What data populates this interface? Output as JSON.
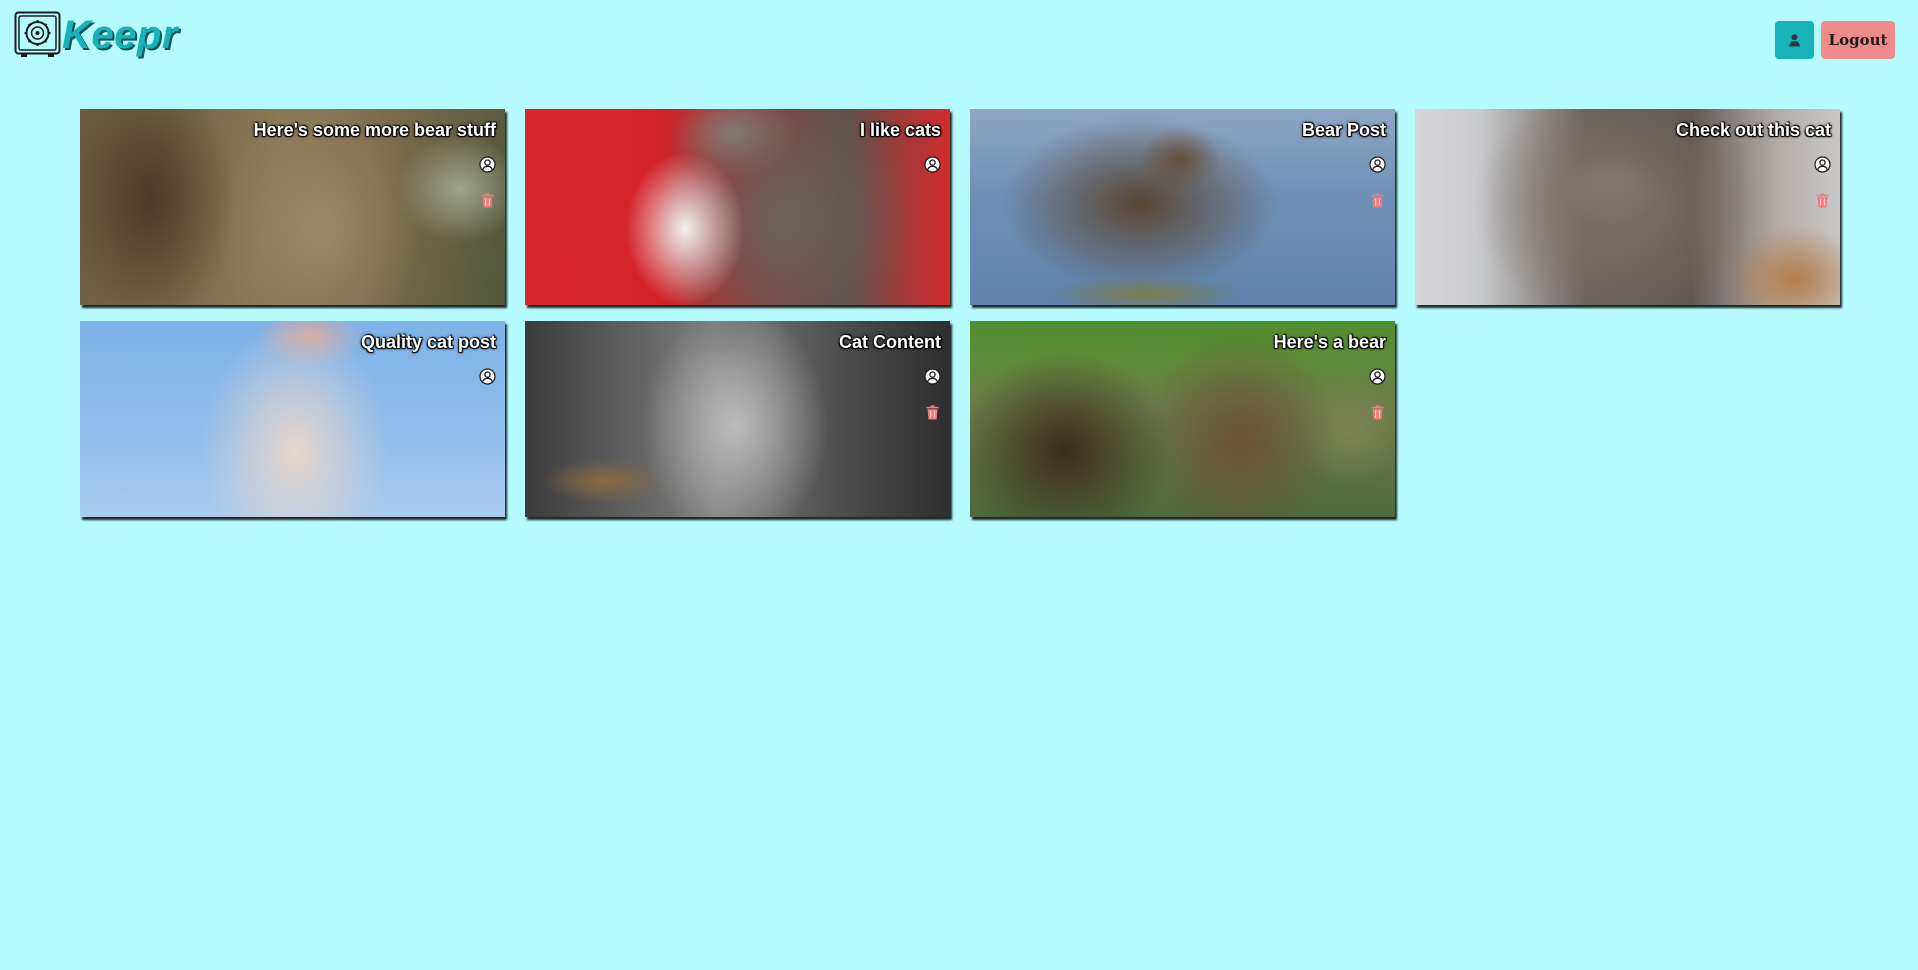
{
  "app": {
    "brand": "Keepr"
  },
  "header": {
    "profile_icon": "user-icon",
    "logout_label": "Logout"
  },
  "colors": {
    "background": "#b6fbff",
    "brand": "#17b3b8",
    "profile_button": "#17b3b8",
    "logout_button": "#ef8a8b",
    "delete_icon": "#ef7d7f"
  },
  "keeps": [
    {
      "title": "Here's some more bear stuff",
      "image": "bear-closeup",
      "has_delete": true
    },
    {
      "title": "I like cats",
      "image": "cat-red-background",
      "has_delete": false
    },
    {
      "title": "Bear Post",
      "image": "bear-in-water",
      "has_delete": true
    },
    {
      "title": "Check out this cat",
      "image": "tabby-kitten",
      "has_delete": true
    },
    {
      "title": "Quality cat post",
      "image": "white-cat-sky",
      "has_delete": false
    },
    {
      "title": "Cat Content",
      "image": "gray-kitten",
      "has_delete": true
    },
    {
      "title": "Here's a bear",
      "image": "two-bears",
      "has_delete": true
    }
  ]
}
